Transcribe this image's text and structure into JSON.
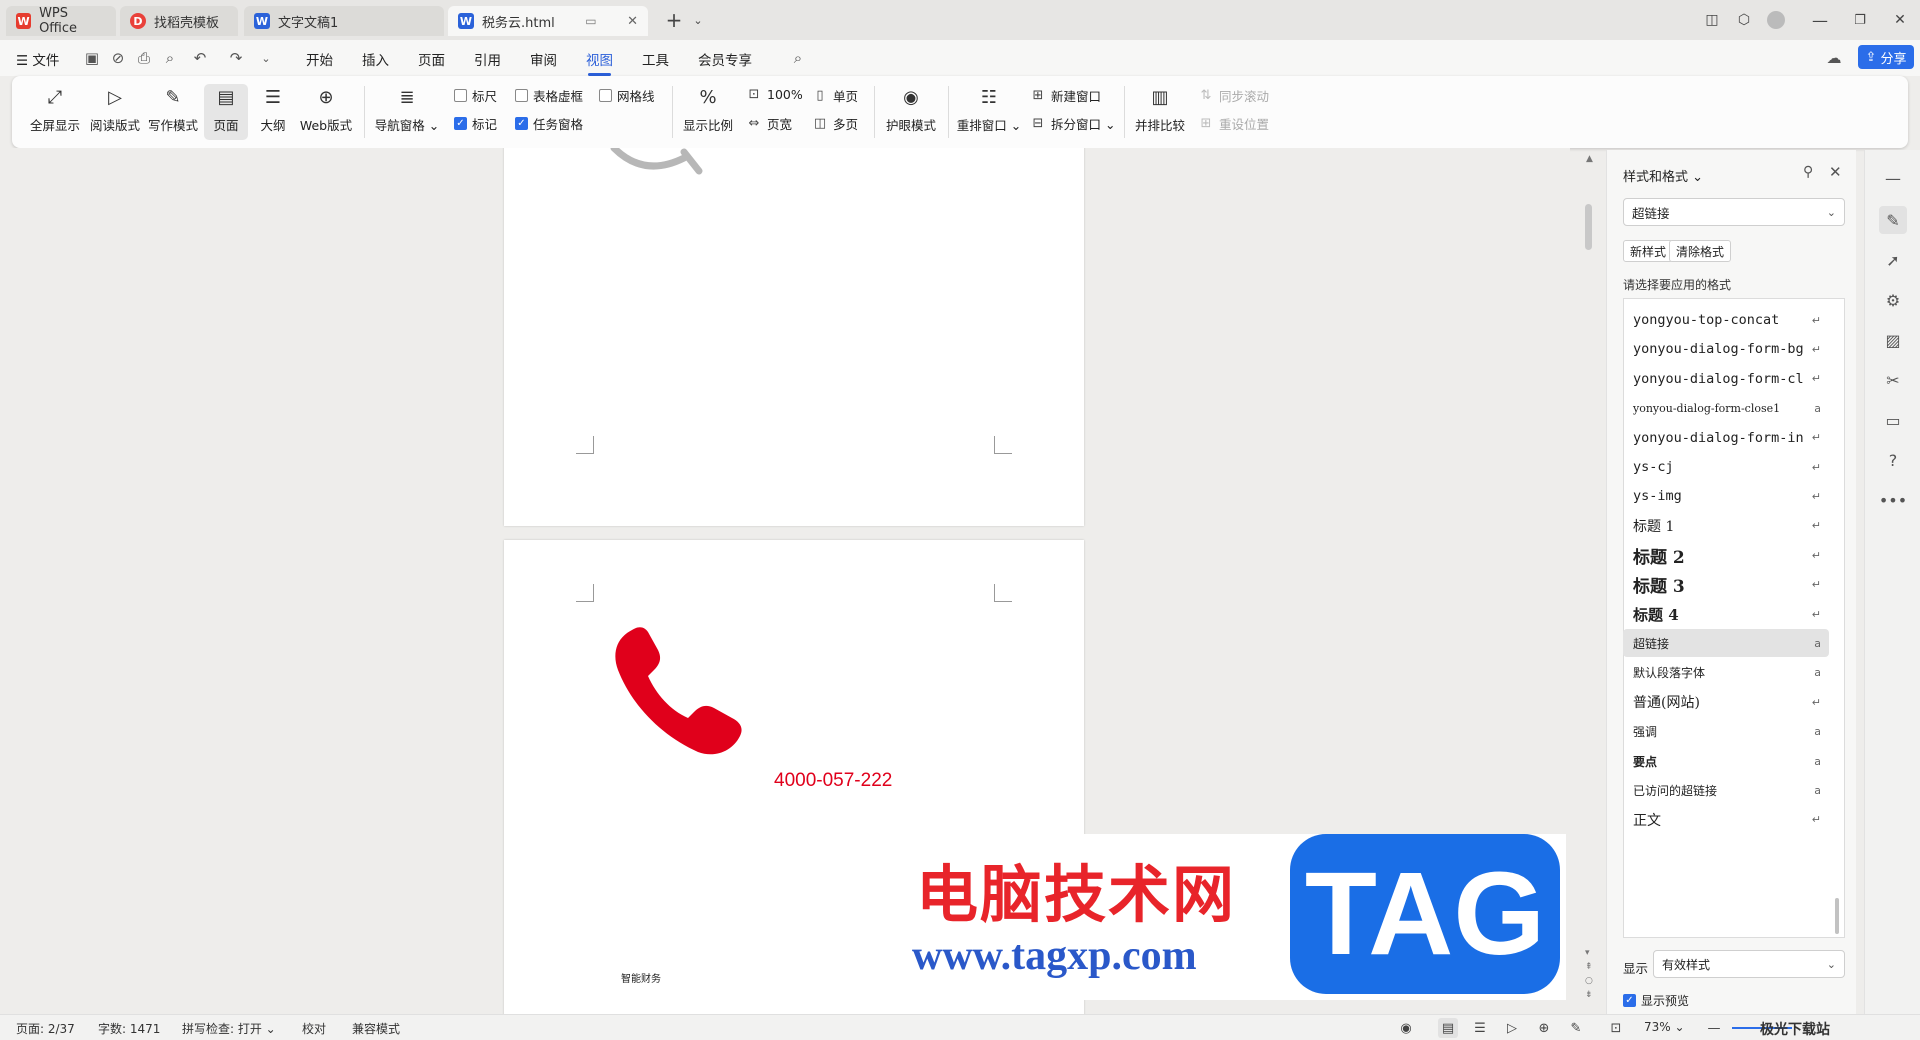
{
  "tabs": [
    {
      "label": "WPS Office",
      "icon": "wps-logo-icon"
    },
    {
      "label": "找稻壳模板",
      "icon": "docer-icon"
    },
    {
      "label": "文字文稿1",
      "icon": "writer-doc-icon"
    },
    {
      "label": "税务云.html",
      "icon": "writer-doc-icon"
    }
  ],
  "menu": {
    "file": "文件",
    "items": [
      "开始",
      "插入",
      "页面",
      "引用",
      "审阅",
      "视图",
      "工具",
      "会员专享"
    ],
    "active": "视图",
    "share": "分享"
  },
  "ribbon": {
    "big_buttons": [
      "全屏显示",
      "阅读版式",
      "写作模式",
      "页面",
      "大纲",
      "Web版式"
    ],
    "nav_pane": "导航窗格",
    "checks": {
      "ruler": "标尺",
      "table_grid": "表格虚框",
      "gridlines": "网格线",
      "marks": "标记",
      "task_pane": "任务窗格"
    },
    "zoom_group": {
      "zoom": "显示比例",
      "hundred": "100%",
      "page_width": "页宽",
      "single": "单页",
      "multi": "多页"
    },
    "eye_mode": "护眼模式",
    "rearrange": "重排窗口",
    "new_window": "新建窗口",
    "split_window": "拆分窗口",
    "side_by_side": "并排比较",
    "sync_scroll": "同步滚动",
    "reset_position": "重设位置"
  },
  "document": {
    "phone_number": "4000-057-222",
    "footer_text": "智能财务",
    "accent_red": "#e0001b"
  },
  "watermark": {
    "title": "电脑技术网",
    "url": "www.tagxp.com",
    "tag": "TAG",
    "corner": "极光下载站"
  },
  "style_panel": {
    "title": "样式和格式",
    "current_style": "超链接",
    "new_style": "新样式",
    "clear_format": "清除格式",
    "prompt": "请选择要应用的格式",
    "styles": [
      {
        "name": "yongyou-top-concat",
        "mark": "↵"
      },
      {
        "name": "yonyou-dialog-form-bg",
        "mark": "↵"
      },
      {
        "name": "yonyou-dialog-form-cl",
        "mark": "↵"
      },
      {
        "name": "yonyou-dialog-form-close1",
        "mark": "a"
      },
      {
        "name": "yonyou-dialog-form-in",
        "mark": "↵"
      },
      {
        "name": "ys-cj",
        "mark": "↵"
      },
      {
        "name": "ys-img",
        "mark": "↵"
      },
      {
        "name": "标题 1",
        "mark": "↵"
      },
      {
        "name": "标题 2",
        "mark": "↵"
      },
      {
        "name": "标题 3",
        "mark": "↵"
      },
      {
        "name": "标题 4",
        "mark": "↵"
      },
      {
        "name": "超链接",
        "mark": "a"
      },
      {
        "name": "默认段落字体",
        "mark": "a"
      },
      {
        "name": "普通(网站)",
        "mark": "↵"
      },
      {
        "name": "强调",
        "mark": "a"
      },
      {
        "name": "要点",
        "mark": "a"
      },
      {
        "name": "已访问的超链接",
        "mark": "a"
      },
      {
        "name": "正文",
        "mark": "↵"
      }
    ],
    "show_label": "显示",
    "show_value": "有效样式",
    "preview_label": "显示预览"
  },
  "status": {
    "page": "页面: 2/37",
    "words": "字数: 1471",
    "spell": "拼写检查: 打开",
    "proof": "校对",
    "compat": "兼容模式",
    "zoom": "73%"
  }
}
